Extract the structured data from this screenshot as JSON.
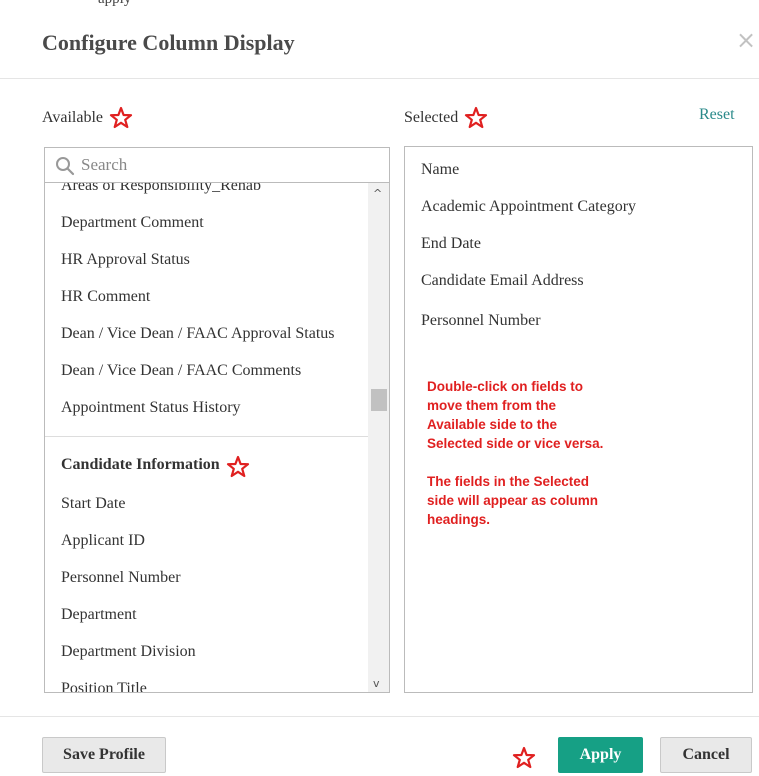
{
  "top_fragment": "apply",
  "dialog": {
    "title": "Configure Column Display",
    "close_glyph": "×"
  },
  "available": {
    "label": "Available",
    "search_placeholder": "Search",
    "items": [
      "Areas of Responsibility_Rehab",
      "Department Comment",
      "HR Approval Status",
      "HR Comment",
      "Dean / Vice Dean / FAAC Approval Status",
      "Dean / Vice Dean / FAAC Comments",
      "Appointment Status History"
    ],
    "group": {
      "heading": "Candidate Information",
      "items": [
        "Start Date",
        "Applicant ID",
        "Personnel Number",
        "Department",
        "Department Division",
        "Position Title"
      ]
    }
  },
  "selected": {
    "label": "Selected",
    "reset_label": "Reset",
    "items": [
      "Name",
      "Academic Appointment Category",
      "End Date",
      "Candidate Email Address",
      "Personnel Number"
    ],
    "note_lines": [
      "Double-click on fields to",
      "move them from the",
      "Available side to the",
      "Selected side or vice versa.",
      "",
      "The fields in the Selected",
      "side will appear as column",
      "headings."
    ]
  },
  "footer": {
    "save_profile": "Save Profile",
    "apply": "Apply",
    "cancel": "Cancel"
  },
  "colors": {
    "annotation_red": "#e02020",
    "apply_green": "#16a085",
    "reset_link": "#2a8a8a"
  },
  "icons": {
    "annotation": "star-outline-icon",
    "search": "search-icon",
    "close": "close-icon"
  }
}
